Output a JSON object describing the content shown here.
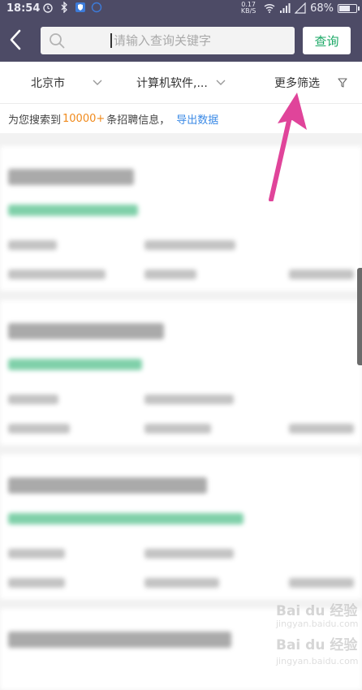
{
  "status_bar": {
    "time": "18:54",
    "network_speed_value": "0.17",
    "network_speed_unit": "KB/S",
    "battery_text": "68%",
    "battery_level": 0.68
  },
  "header": {
    "search_placeholder": "请输入查询关键字",
    "search_button_label": "查询"
  },
  "filters": {
    "city": "北京市",
    "industry": "计算机软件,...",
    "more": "更多筛选"
  },
  "results": {
    "prefix": "为您搜索到",
    "count": "10000+",
    "suffix": "条招聘信息，",
    "export_label": "导出数据"
  },
  "watermark": {
    "line1": "Bai du 经验",
    "line2": "jingyan.baidu.com",
    "line3": "Bai du 经验",
    "line4": "jingyan.baidu.com"
  },
  "colors": {
    "header_bg": "#4d4b66",
    "accent_green": "#1aa865",
    "count_orange": "#f08a1c",
    "link_blue": "#3b8ae6",
    "arrow_pink": "#e0449a"
  }
}
